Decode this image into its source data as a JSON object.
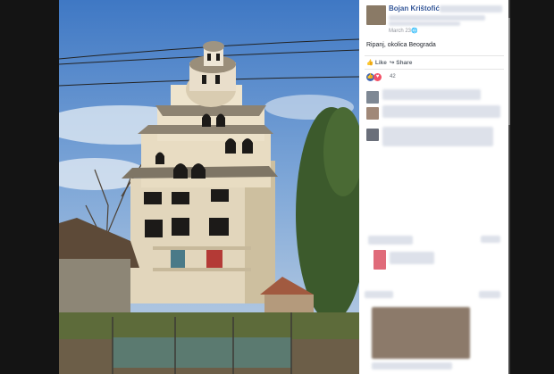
{
  "post": {
    "author": "Bojan Krištofić",
    "date": "March 23",
    "caption": "Ripanj, okolica Beograda",
    "like_label": "Like",
    "share_label": "Share",
    "reaction_count": "42"
  },
  "icons": {
    "expand": "expand-icon",
    "privacy": "globe-icon",
    "like": "thumbs-up-icon",
    "share": "share-arrow-icon",
    "reaction_like": "like-reaction-icon",
    "reaction_love": "love-reaction-icon"
  },
  "colors": {
    "link_blue": "#365899",
    "like_blue": "#4267b2",
    "love_red": "#f25268"
  }
}
